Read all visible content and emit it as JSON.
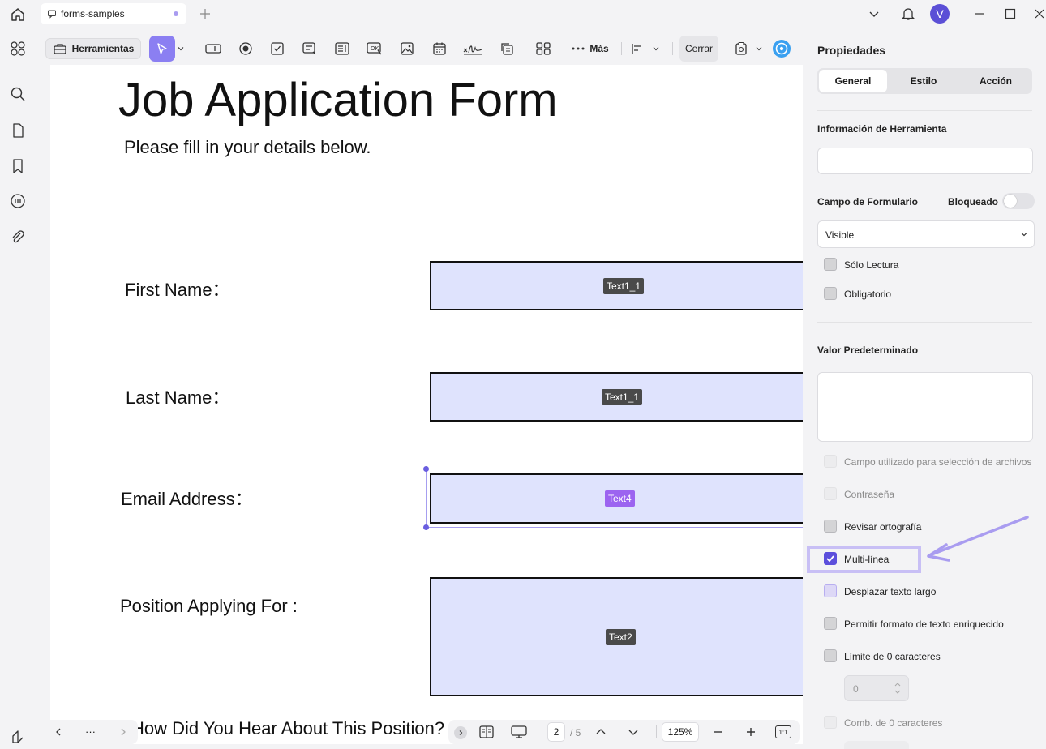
{
  "titlebar": {
    "tab_label": "forms-samples",
    "avatar_letter": "V"
  },
  "toolbar": {
    "tools_label": "Herramientas",
    "more_label": "Más",
    "close_label": "Cerrar"
  },
  "document": {
    "title": "Job Application Form",
    "subtitle": "Please fill in your details below.",
    "fields": [
      {
        "label": "First Name：",
        "tag": "Text1_1"
      },
      {
        "label": "Last Name：",
        "tag": "Text1_1"
      },
      {
        "label": "Email Address：",
        "tag": "Text4"
      },
      {
        "label": "Position Applying For :",
        "tag": "Text2"
      },
      {
        "label": "How Did You Hear About This Position?"
      }
    ]
  },
  "panel": {
    "title": "Propiedades",
    "tabs": [
      "General",
      "Estilo",
      "Acción"
    ],
    "tooltip_label": "Información de Herramienta",
    "form_field_label": "Campo de Formulario",
    "locked_label": "Bloqueado",
    "visibility_value": "Visible",
    "readonly_label": "Sólo Lectura",
    "required_label": "Obligatorio",
    "default_value_label": "Valor Predeterminado",
    "options": [
      {
        "label": "Campo utilizado para selección de archivos",
        "checked": false,
        "enabled": false
      },
      {
        "label": "Contraseña",
        "checked": false,
        "enabled": false
      },
      {
        "label": "Revisar ortografía",
        "checked": false,
        "enabled": true
      },
      {
        "label": "Multi-línea",
        "checked": true,
        "enabled": true
      },
      {
        "label": "Desplazar texto largo",
        "checked": false,
        "enabled": true
      },
      {
        "label": "Permitir formato de texto enriquecido",
        "checked": false,
        "enabled": true
      },
      {
        "label": "Límite de 0 caracteres",
        "checked": false,
        "enabled": true
      },
      {
        "label": "Comb. de 0 caracteres",
        "checked": false,
        "enabled": false
      }
    ],
    "char_limit_value": "0"
  },
  "bottom": {
    "nav_more": "···",
    "page_current": "2",
    "page_total": "/ 5",
    "zoom": "125%",
    "fit_label": "1:1"
  },
  "colors": {
    "accent": "#5c4fdc",
    "highlight": "#c8bff5",
    "field_fill": "#dfe3fd",
    "active_tag": "#9c64f0"
  }
}
